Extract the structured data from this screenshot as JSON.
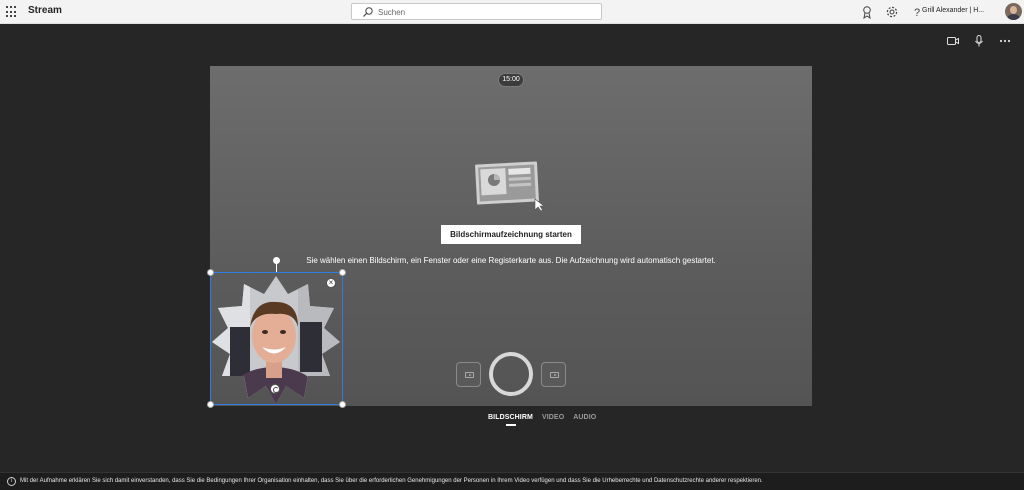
{
  "topbar": {
    "app_title": "Stream",
    "search_placeholder": "Suchen",
    "user_name": "Grill Alexander | H..."
  },
  "stage": {
    "timer": "15:00",
    "start_button_label": "Bildschirmaufzeichnung starten",
    "hint_text": "Sie wählen einen Bildschirm, ein Fenster oder eine Registerkarte aus. Die Aufzeichnung wird automatisch gestartet."
  },
  "tabs": [
    {
      "label": "BILDSCHIRM",
      "active": true
    },
    {
      "label": "VIDEO",
      "active": false
    },
    {
      "label": "AUDIO",
      "active": false
    }
  ],
  "footer": {
    "info_icon": "i",
    "disclaimer": "Mit der Aufnahme erklären Sie sich damit einverstanden, dass Sie die Bedingungen Ihrer Organisation einhalten, dass Sie über die erforderlichen Genehmigungen der Personen in Ihrem Video verfügen und dass Sie die Urheberrechte und Datenschutzrechte anderer respektieren."
  },
  "colors": {
    "background": "#262626",
    "topbar": "#f3f3f3",
    "stage": "#636363",
    "selection_border": "#2f7de1"
  }
}
